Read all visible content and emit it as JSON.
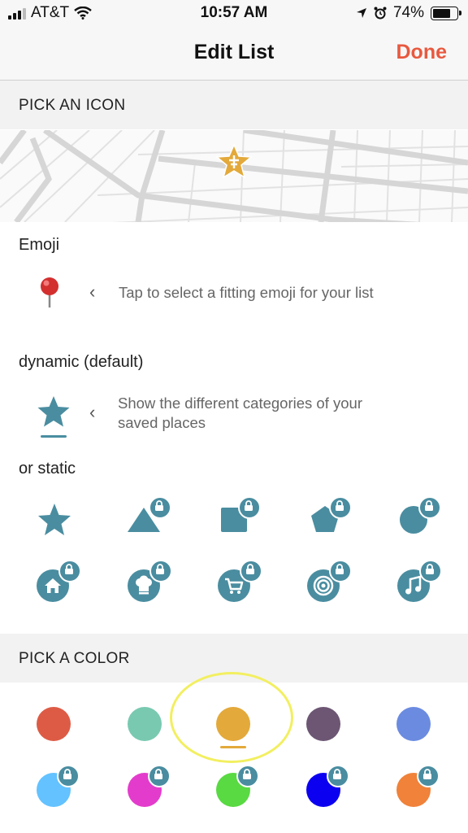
{
  "status": {
    "carrier": "AT&T",
    "time": "10:57 AM",
    "battery": "74%"
  },
  "nav": {
    "title": "Edit List",
    "done_label": "Done"
  },
  "icon_section": {
    "header": "PICK AN ICON"
  },
  "emoji": {
    "label": "Emoji",
    "hint": "Tap to select a fitting emoji for your list",
    "icon": "pushpin-emoji"
  },
  "dynamic": {
    "label": "dynamic (default)",
    "hint_line1": "Show the different categories of your",
    "hint_line2": "saved places",
    "icon": "star-icon"
  },
  "static": {
    "label": "or static",
    "row1": [
      "star",
      "triangle",
      "square",
      "pentagon",
      "circle"
    ],
    "row2": [
      "home",
      "chef-hat",
      "cart",
      "target",
      "music-note"
    ]
  },
  "color_section": {
    "header": "PICK A COLOR"
  },
  "colors": {
    "row1": [
      "#dd5b45",
      "#79c9b1",
      "#e3a93a",
      "#6c5673",
      "#6b8be0"
    ],
    "row2": [
      "#63c2ff",
      "#e33ccc",
      "#59d942",
      "#0c00f0",
      "#f0823a"
    ],
    "selected": "#e3a93a"
  },
  "theme": {
    "accent": "#e8593f",
    "icon_color": "#4a8da0"
  }
}
